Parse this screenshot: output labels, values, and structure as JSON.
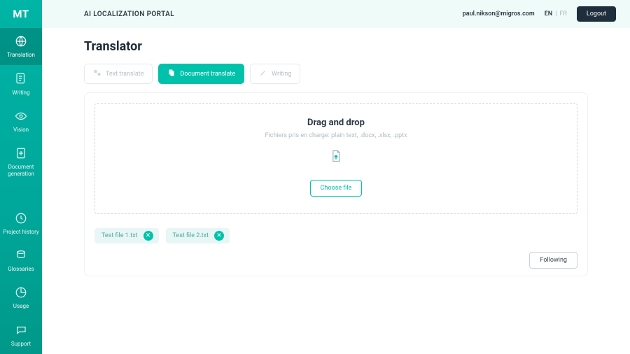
{
  "logo_text": "MT",
  "header": {
    "portal_title": "AI LOCALIZATION PORTAL",
    "user_email": "paul.nikson@migros.com",
    "lang_active": "EN",
    "lang_separator": "|",
    "lang_inactive": "FR",
    "logout_label": "Logout"
  },
  "sidebar": {
    "items_top": [
      {
        "label": "Translation"
      },
      {
        "label": "Writing"
      },
      {
        "label": "Vision"
      },
      {
        "label": "Document generation"
      }
    ],
    "items_bottom": [
      {
        "label": "Project history"
      },
      {
        "label": "Glossaries"
      },
      {
        "label": "Usage"
      },
      {
        "label": "Support"
      }
    ]
  },
  "page_title": "Translator",
  "tabs": [
    {
      "label": "Text translate"
    },
    {
      "label": "Document translate"
    },
    {
      "label": "Writing"
    }
  ],
  "dropzone": {
    "title": "Drag and drop",
    "subtitle": "Fichiers pris en charge: plain text, .docx, .xlsx, .pptx",
    "choose_label": "Choose file"
  },
  "files": [
    {
      "name": "Test file 1.txt"
    },
    {
      "name": "Test file 2.txt"
    }
  ],
  "following_label": "Following",
  "colors": {
    "accent": "#00c2ab",
    "sidebar": "#00a79a",
    "header_bg": "#effbf8",
    "chip_bg": "#e8f6f5",
    "logout_bg": "#1f2e3d"
  }
}
